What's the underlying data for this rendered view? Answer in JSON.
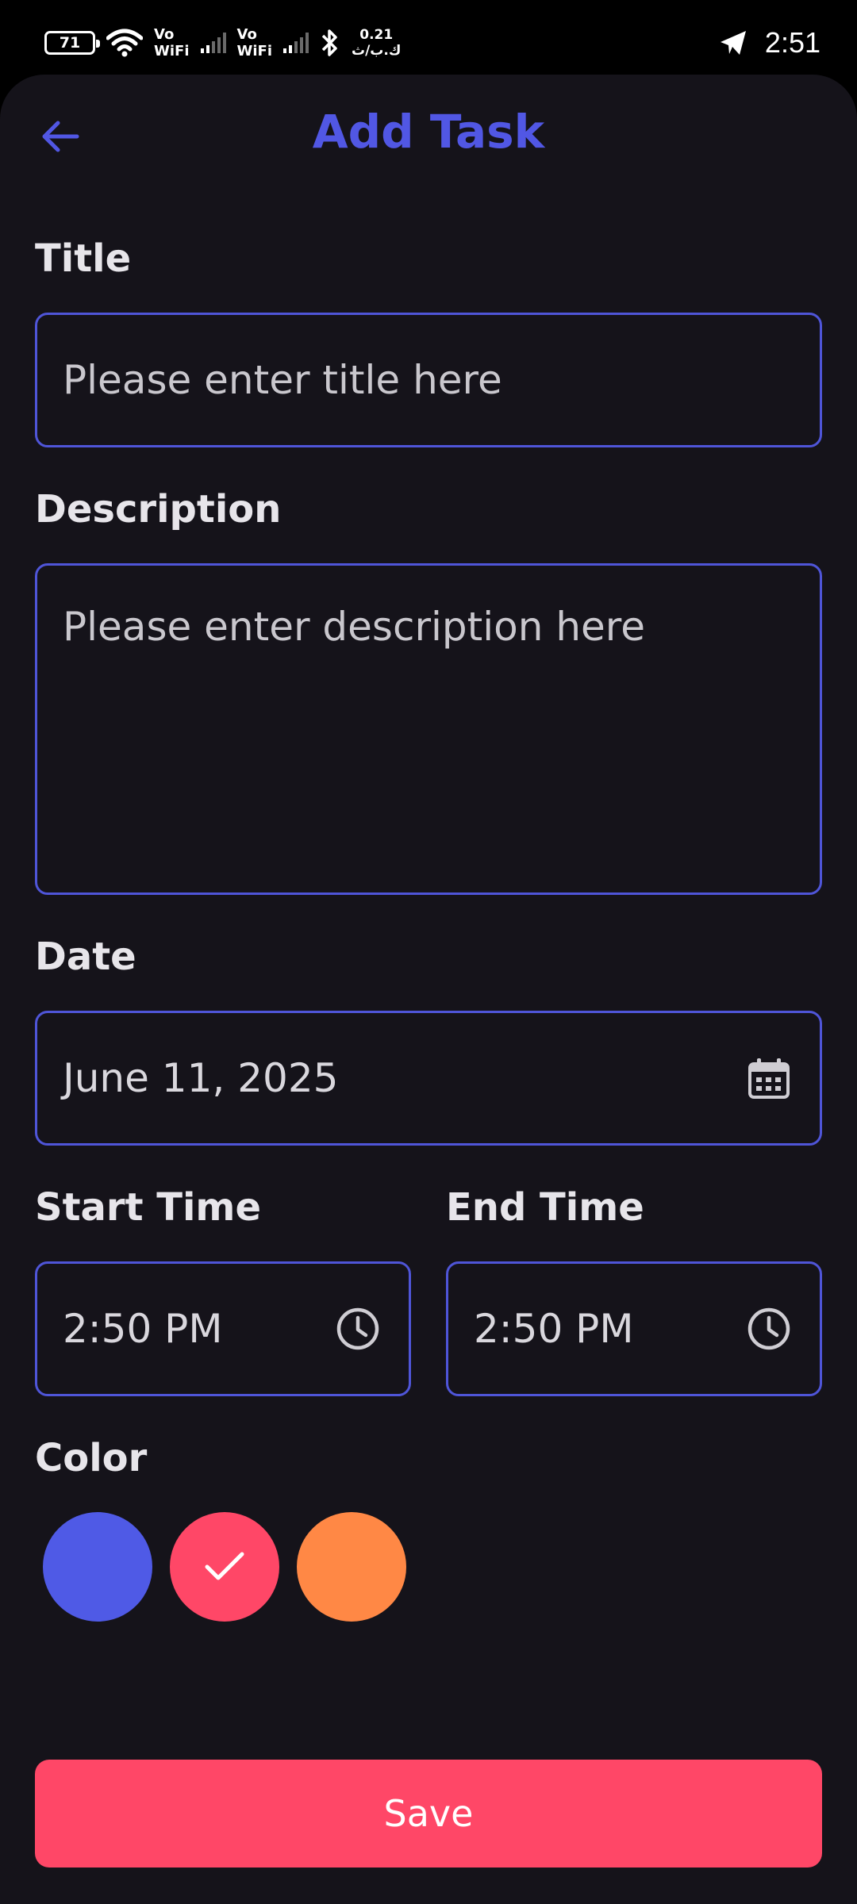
{
  "status_bar": {
    "battery": "71",
    "vowifi_1": [
      "Vo",
      "WiFi"
    ],
    "vowifi_2": [
      "Vo",
      "WiFi"
    ],
    "net_speed": [
      "0.21",
      "ك.ب/ث"
    ],
    "time": "2:51"
  },
  "header": {
    "title": "Add Task",
    "back_icon": "arrow-left-icon"
  },
  "form": {
    "title_label": "Title",
    "title_placeholder": "Please enter title here",
    "description_label": "Description",
    "description_placeholder": "Please enter description here",
    "date_label": "Date",
    "date_value": "June 11, 2025",
    "date_icon": "calendar-icon",
    "start_time_label": "Start Time",
    "start_time_value": "2:50 PM",
    "end_time_label": "End Time",
    "end_time_value": "2:50 PM",
    "time_icon": "clock-icon",
    "color_label": "Color",
    "colors": [
      {
        "hex": "#4f5ae6",
        "selected": false
      },
      {
        "hex": "#ff4767",
        "selected": true
      },
      {
        "hex": "#ff8845",
        "selected": false
      }
    ],
    "save_label": "Save"
  },
  "theme": {
    "accent": "#4f55d8",
    "background": "#15131a",
    "save": "#ff4767"
  }
}
